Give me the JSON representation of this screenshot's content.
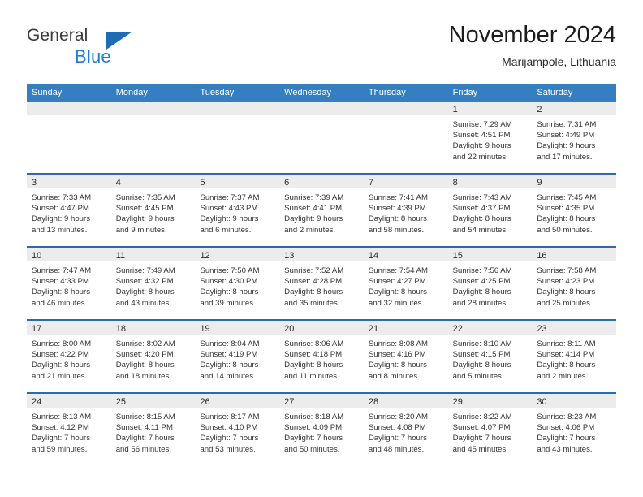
{
  "brand": {
    "line1": "General",
    "line2": "Blue",
    "logo_icon": "triangle-logo-icon",
    "accent_color": "#1a7fd4",
    "triangle_color": "#1d6cb4"
  },
  "header": {
    "title": "November 2024",
    "location": "Marijampole, Lithuania"
  },
  "theme": {
    "header_bg": "#347ec1",
    "row_separator": "#2a6ba8",
    "day_band_bg": "#ececec",
    "cell_bg": "#ffffff"
  },
  "weekdays": [
    "Sunday",
    "Monday",
    "Tuesday",
    "Wednesday",
    "Thursday",
    "Friday",
    "Saturday"
  ],
  "weeks": [
    [
      {
        "day": "",
        "empty": true
      },
      {
        "day": "",
        "empty": true
      },
      {
        "day": "",
        "empty": true
      },
      {
        "day": "",
        "empty": true
      },
      {
        "day": "",
        "empty": true
      },
      {
        "day": "1",
        "sunrise": "Sunrise: 7:29 AM",
        "sunset": "Sunset: 4:51 PM",
        "daylight1": "Daylight: 9 hours",
        "daylight2": "and 22 minutes."
      },
      {
        "day": "2",
        "sunrise": "Sunrise: 7:31 AM",
        "sunset": "Sunset: 4:49 PM",
        "daylight1": "Daylight: 9 hours",
        "daylight2": "and 17 minutes."
      }
    ],
    [
      {
        "day": "3",
        "sunrise": "Sunrise: 7:33 AM",
        "sunset": "Sunset: 4:47 PM",
        "daylight1": "Daylight: 9 hours",
        "daylight2": "and 13 minutes."
      },
      {
        "day": "4",
        "sunrise": "Sunrise: 7:35 AM",
        "sunset": "Sunset: 4:45 PM",
        "daylight1": "Daylight: 9 hours",
        "daylight2": "and 9 minutes."
      },
      {
        "day": "5",
        "sunrise": "Sunrise: 7:37 AM",
        "sunset": "Sunset: 4:43 PM",
        "daylight1": "Daylight: 9 hours",
        "daylight2": "and 6 minutes."
      },
      {
        "day": "6",
        "sunrise": "Sunrise: 7:39 AM",
        "sunset": "Sunset: 4:41 PM",
        "daylight1": "Daylight: 9 hours",
        "daylight2": "and 2 minutes."
      },
      {
        "day": "7",
        "sunrise": "Sunrise: 7:41 AM",
        "sunset": "Sunset: 4:39 PM",
        "daylight1": "Daylight: 8 hours",
        "daylight2": "and 58 minutes."
      },
      {
        "day": "8",
        "sunrise": "Sunrise: 7:43 AM",
        "sunset": "Sunset: 4:37 PM",
        "daylight1": "Daylight: 8 hours",
        "daylight2": "and 54 minutes."
      },
      {
        "day": "9",
        "sunrise": "Sunrise: 7:45 AM",
        "sunset": "Sunset: 4:35 PM",
        "daylight1": "Daylight: 8 hours",
        "daylight2": "and 50 minutes."
      }
    ],
    [
      {
        "day": "10",
        "sunrise": "Sunrise: 7:47 AM",
        "sunset": "Sunset: 4:33 PM",
        "daylight1": "Daylight: 8 hours",
        "daylight2": "and 46 minutes."
      },
      {
        "day": "11",
        "sunrise": "Sunrise: 7:49 AM",
        "sunset": "Sunset: 4:32 PM",
        "daylight1": "Daylight: 8 hours",
        "daylight2": "and 43 minutes."
      },
      {
        "day": "12",
        "sunrise": "Sunrise: 7:50 AM",
        "sunset": "Sunset: 4:30 PM",
        "daylight1": "Daylight: 8 hours",
        "daylight2": "and 39 minutes."
      },
      {
        "day": "13",
        "sunrise": "Sunrise: 7:52 AM",
        "sunset": "Sunset: 4:28 PM",
        "daylight1": "Daylight: 8 hours",
        "daylight2": "and 35 minutes."
      },
      {
        "day": "14",
        "sunrise": "Sunrise: 7:54 AM",
        "sunset": "Sunset: 4:27 PM",
        "daylight1": "Daylight: 8 hours",
        "daylight2": "and 32 minutes."
      },
      {
        "day": "15",
        "sunrise": "Sunrise: 7:56 AM",
        "sunset": "Sunset: 4:25 PM",
        "daylight1": "Daylight: 8 hours",
        "daylight2": "and 28 minutes."
      },
      {
        "day": "16",
        "sunrise": "Sunrise: 7:58 AM",
        "sunset": "Sunset: 4:23 PM",
        "daylight1": "Daylight: 8 hours",
        "daylight2": "and 25 minutes."
      }
    ],
    [
      {
        "day": "17",
        "sunrise": "Sunrise: 8:00 AM",
        "sunset": "Sunset: 4:22 PM",
        "daylight1": "Daylight: 8 hours",
        "daylight2": "and 21 minutes."
      },
      {
        "day": "18",
        "sunrise": "Sunrise: 8:02 AM",
        "sunset": "Sunset: 4:20 PM",
        "daylight1": "Daylight: 8 hours",
        "daylight2": "and 18 minutes."
      },
      {
        "day": "19",
        "sunrise": "Sunrise: 8:04 AM",
        "sunset": "Sunset: 4:19 PM",
        "daylight1": "Daylight: 8 hours",
        "daylight2": "and 14 minutes."
      },
      {
        "day": "20",
        "sunrise": "Sunrise: 8:06 AM",
        "sunset": "Sunset: 4:18 PM",
        "daylight1": "Daylight: 8 hours",
        "daylight2": "and 11 minutes."
      },
      {
        "day": "21",
        "sunrise": "Sunrise: 8:08 AM",
        "sunset": "Sunset: 4:16 PM",
        "daylight1": "Daylight: 8 hours",
        "daylight2": "and 8 minutes."
      },
      {
        "day": "22",
        "sunrise": "Sunrise: 8:10 AM",
        "sunset": "Sunset: 4:15 PM",
        "daylight1": "Daylight: 8 hours",
        "daylight2": "and 5 minutes."
      },
      {
        "day": "23",
        "sunrise": "Sunrise: 8:11 AM",
        "sunset": "Sunset: 4:14 PM",
        "daylight1": "Daylight: 8 hours",
        "daylight2": "and 2 minutes."
      }
    ],
    [
      {
        "day": "24",
        "sunrise": "Sunrise: 8:13 AM",
        "sunset": "Sunset: 4:12 PM",
        "daylight1": "Daylight: 7 hours",
        "daylight2": "and 59 minutes."
      },
      {
        "day": "25",
        "sunrise": "Sunrise: 8:15 AM",
        "sunset": "Sunset: 4:11 PM",
        "daylight1": "Daylight: 7 hours",
        "daylight2": "and 56 minutes."
      },
      {
        "day": "26",
        "sunrise": "Sunrise: 8:17 AM",
        "sunset": "Sunset: 4:10 PM",
        "daylight1": "Daylight: 7 hours",
        "daylight2": "and 53 minutes."
      },
      {
        "day": "27",
        "sunrise": "Sunrise: 8:18 AM",
        "sunset": "Sunset: 4:09 PM",
        "daylight1": "Daylight: 7 hours",
        "daylight2": "and 50 minutes."
      },
      {
        "day": "28",
        "sunrise": "Sunrise: 8:20 AM",
        "sunset": "Sunset: 4:08 PM",
        "daylight1": "Daylight: 7 hours",
        "daylight2": "and 48 minutes."
      },
      {
        "day": "29",
        "sunrise": "Sunrise: 8:22 AM",
        "sunset": "Sunset: 4:07 PM",
        "daylight1": "Daylight: 7 hours",
        "daylight2": "and 45 minutes."
      },
      {
        "day": "30",
        "sunrise": "Sunrise: 8:23 AM",
        "sunset": "Sunset: 4:06 PM",
        "daylight1": "Daylight: 7 hours",
        "daylight2": "and 43 minutes."
      }
    ]
  ]
}
